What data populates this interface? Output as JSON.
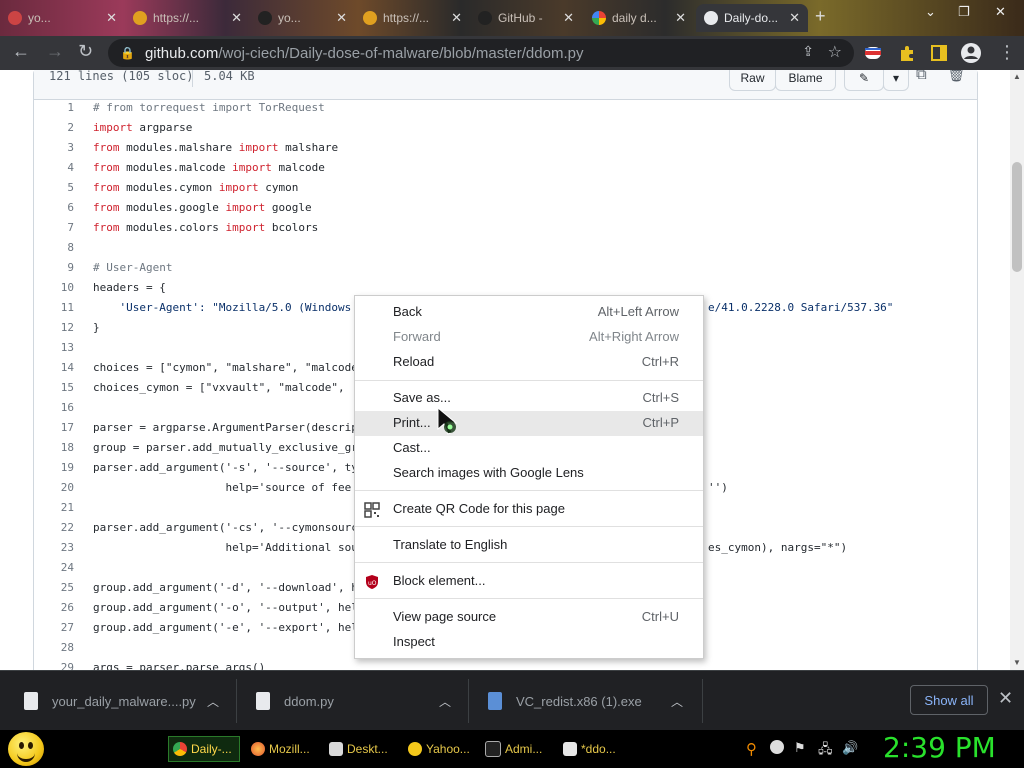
{
  "browser": {
    "tabs": [
      {
        "title": "yo...",
        "close": "✕"
      },
      {
        "title": "https://...",
        "close": "✕"
      },
      {
        "title": "yo...",
        "close": "✕"
      },
      {
        "title": "https://...",
        "close": "✕"
      },
      {
        "title": "GitHub -",
        "close": "✕"
      },
      {
        "title": "daily d...",
        "close": "✕"
      },
      {
        "title": "Daily-do...",
        "close": "✕"
      }
    ],
    "new_tab": "+",
    "address_host": "github.com",
    "address_path": "/woj-ciech/Daily-dose-of-malware/blob/master/ddom.py"
  },
  "file": {
    "lines_info": "121 lines (105 sloc)",
    "size": "5.04 KB",
    "raw_label": "Raw",
    "blame_label": "Blame"
  },
  "code_lines": [
    {
      "n": "1",
      "t": "# from torrequest import TorRequest"
    },
    {
      "n": "2",
      "t": "import argparse"
    },
    {
      "n": "3",
      "t": "from modules.malshare import malshare"
    },
    {
      "n": "4",
      "t": "from modules.malcode import malcode"
    },
    {
      "n": "5",
      "t": "from modules.cymon import cymon"
    },
    {
      "n": "6",
      "t": "from modules.google import google"
    },
    {
      "n": "7",
      "t": "from modules.colors import bcolors"
    },
    {
      "n": "8",
      "t": ""
    },
    {
      "n": "9",
      "t": "# User-Agent"
    },
    {
      "n": "10",
      "t": "headers = {"
    },
    {
      "n": "11",
      "t": "    'User-Agent': \"Mozilla/5.0 (Windows"
    },
    {
      "n": "12",
      "t": "}"
    },
    {
      "n": "13",
      "t": ""
    },
    {
      "n": "14",
      "t": "choices = [\"cymon\", \"malshare\", \"malcode"
    },
    {
      "n": "15",
      "t": "choices_cymon = [\"vxvault\", \"malcode\", '"
    },
    {
      "n": "16",
      "t": ""
    },
    {
      "n": "17",
      "t": "parser = argparse.ArgumentParser(descrip"
    },
    {
      "n": "18",
      "t": "group = parser.add_mutually_exclusive_gr"
    },
    {
      "n": "19",
      "t": "parser.add_argument('-s', '--source', ty"
    },
    {
      "n": "20",
      "t": "                    help='source of fee"
    },
    {
      "n": "21",
      "t": ""
    },
    {
      "n": "22",
      "t": "parser.add_argument('-cs', '--cymonsourc"
    },
    {
      "n": "23",
      "t": "                    help='Additional sou"
    },
    {
      "n": "24",
      "t": ""
    },
    {
      "n": "25",
      "t": "group.add_argument('-d', '--download', h"
    },
    {
      "n": "26",
      "t": "group.add_argument('-o', '--output', hel"
    },
    {
      "n": "27",
      "t": "group.add_argument('-e', '--export', hel"
    },
    {
      "n": "28",
      "t": ""
    },
    {
      "n": "29",
      "t": "args = parser.parse_args()"
    }
  ],
  "code_tails": {
    "line11": "e/41.0.2228.0 Safari/537.36\"",
    "line20": "'')",
    "line23": "es_cymon), nargs=\"*\")"
  },
  "context_menu": {
    "items": [
      {
        "label": "Back",
        "shortcut": "Alt+Left Arrow"
      },
      {
        "label": "Forward",
        "shortcut": "Alt+Right Arrow"
      },
      {
        "label": "Reload",
        "shortcut": "Ctrl+R"
      },
      {
        "label": "Save as...",
        "shortcut": "Ctrl+S"
      },
      {
        "label": "Print...",
        "shortcut": "Ctrl+P"
      },
      {
        "label": "Cast...",
        "shortcut": ""
      },
      {
        "label": "Search images with Google Lens",
        "shortcut": ""
      },
      {
        "label": "Create QR Code for this page",
        "shortcut": ""
      },
      {
        "label": "Translate to English",
        "shortcut": ""
      },
      {
        "label": "Block element...",
        "shortcut": ""
      },
      {
        "label": "View page source",
        "shortcut": "Ctrl+U"
      },
      {
        "label": "Inspect",
        "shortcut": ""
      }
    ]
  },
  "downloads": {
    "items": [
      {
        "name": "your_daily_malware....py"
      },
      {
        "name": "ddom.py"
      },
      {
        "name": "VC_redist.x86 (1).exe"
      }
    ],
    "show_all": "Show all",
    "close": "✕"
  },
  "taskbar": {
    "tasks": [
      {
        "label": "Daily-..."
      },
      {
        "label": "Mozill..."
      },
      {
        "label": "Deskt..."
      },
      {
        "label": "Yahoo..."
      },
      {
        "label": "Admi..."
      },
      {
        "label": "*ddo..."
      }
    ],
    "clock": "2:39 PM"
  },
  "colors": {
    "accent_link": "#8ab4f8",
    "clock_green": "#29e22c",
    "keyword": "#cf222e",
    "function": "#8250df"
  }
}
